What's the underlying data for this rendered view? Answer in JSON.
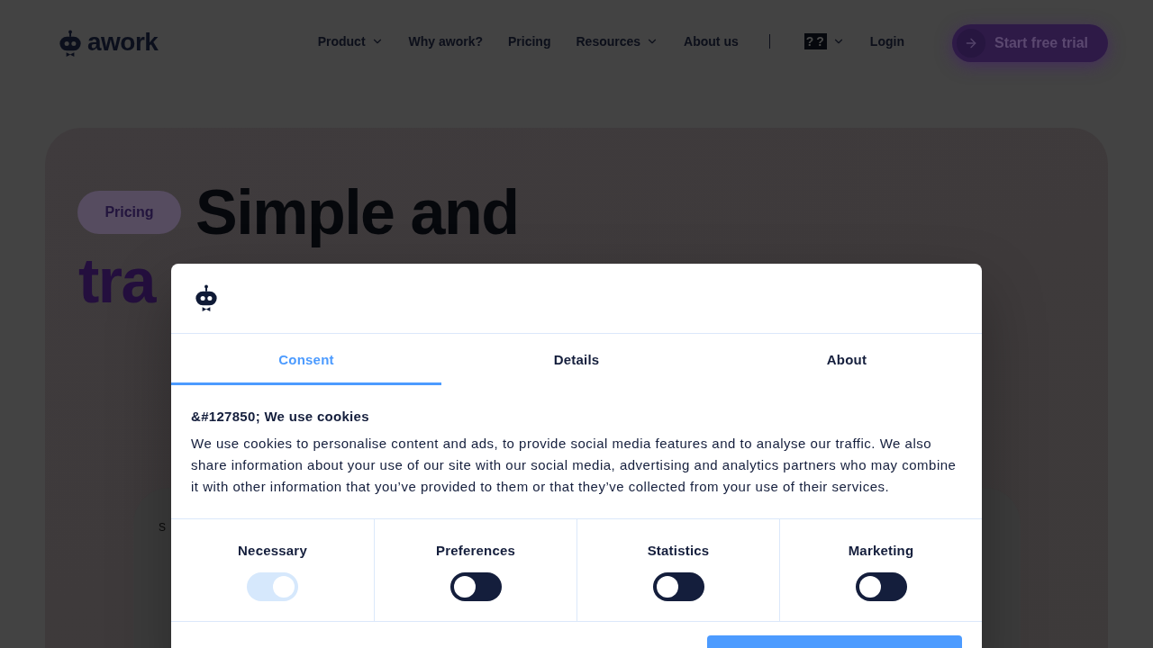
{
  "header": {
    "logo_text": "awork",
    "nav": [
      {
        "label": "Product",
        "dropdown": true
      },
      {
        "label": "Why awork?",
        "dropdown": false
      },
      {
        "label": "Pricing",
        "dropdown": false
      },
      {
        "label": "Resources",
        "dropdown": true
      },
      {
        "label": "About us",
        "dropdown": false
      }
    ],
    "language": {
      "label": "??",
      "dropdown": true
    },
    "login": "Login",
    "cta": "Start free trial"
  },
  "hero": {
    "tag": "Pricing",
    "heading_line_1": "Simple and",
    "heading_line_2": "tra",
    "card": {
      "eyebrow": "S"
    }
  },
  "cookie_dialog": {
    "tabs": [
      {
        "label": "Consent",
        "selected": true
      },
      {
        "label": "Details",
        "selected": false
      },
      {
        "label": "About",
        "selected": false
      }
    ],
    "title": "&#127850; We use cookies",
    "text": "We use cookies to personalise content and ads, to provide social media features and to analyse our traffic. We also share information about your use of our site with our social media, advertising and analytics partners who may combine it with other information that you’ve provided to them or that they’ve collected from your use of their services.",
    "categories": [
      {
        "label": "Necessary",
        "checked": true,
        "disabled": true
      },
      {
        "label": "Preferences",
        "checked": false,
        "disabled": false
      },
      {
        "label": "Statistics",
        "checked": false,
        "disabled": false
      },
      {
        "label": "Marketing",
        "checked": false,
        "disabled": false
      }
    ]
  }
}
